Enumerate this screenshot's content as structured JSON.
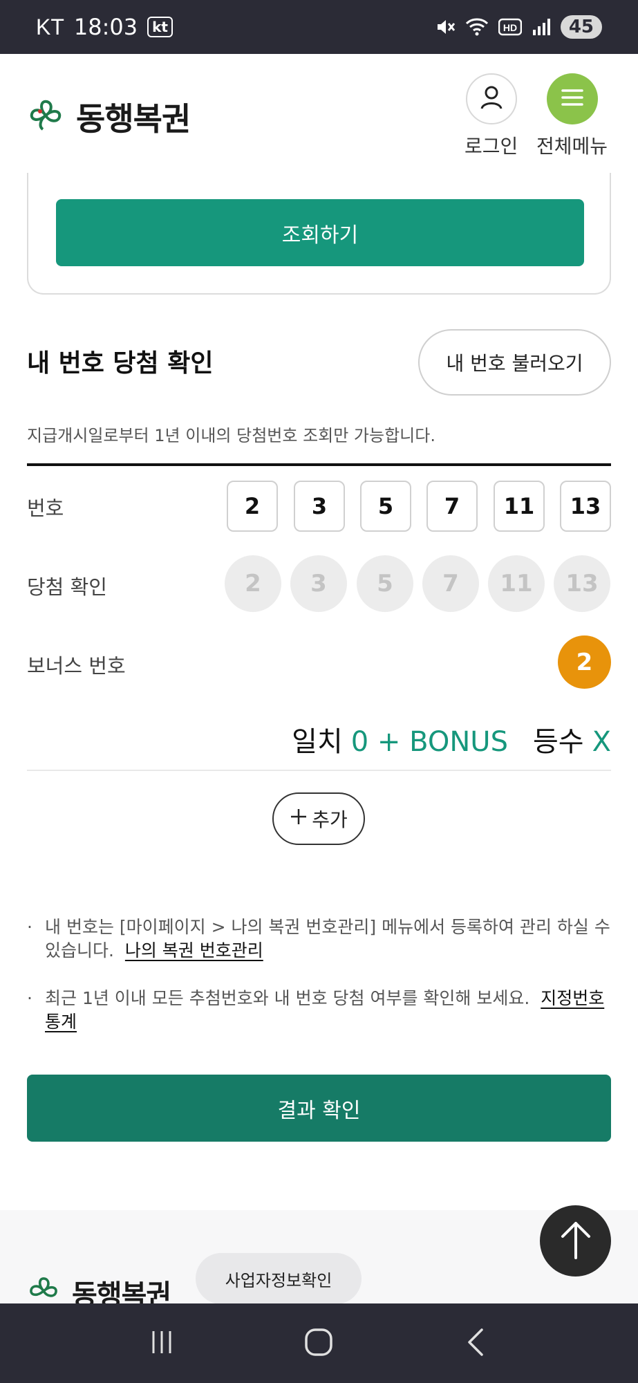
{
  "status_bar": {
    "carrier": "KT",
    "time": "18:03",
    "carrier_badge": "kt",
    "battery": "45"
  },
  "header": {
    "logo_text": "동행복권",
    "login_label": "로그인",
    "menu_label": "전체메뉴"
  },
  "query": {
    "button_label": "조회하기"
  },
  "section": {
    "title": "내 번호 당첨 확인",
    "load_button": "내 번호 불러오기",
    "note": "지급개시일로부터 1년 이내의 당첨번호 조회만 가능합니다."
  },
  "numbers_row": {
    "label": "번호",
    "values": [
      "2",
      "3",
      "5",
      "7",
      "11",
      "13"
    ]
  },
  "match_row": {
    "label": "당첨 확인",
    "values": [
      "2",
      "3",
      "5",
      "7",
      "11",
      "13"
    ]
  },
  "bonus_row": {
    "label": "보너스 번호",
    "value": "2"
  },
  "result": {
    "match_label": "일치",
    "match_value": "0 + BONUS",
    "rank_label": "등수",
    "rank_value": "X"
  },
  "add_button": {
    "label": "추가"
  },
  "info": [
    {
      "text": "내 번호는 [마이페이지 > 나의 복권 번호관리] 메뉴에서 등록하여 관리 하실 수 있습니다.",
      "link": "나의 복권 번호관리"
    },
    {
      "text": "최근 1년 이내 모든 추첨번호와 내 번호 당첨 여부를 확인해 보세요.",
      "link": "지정번호 통계"
    }
  ],
  "result_button": {
    "label": "결과 확인"
  },
  "footer": {
    "logo_text": "동행복권",
    "business_info_button": "사업자정보확인"
  },
  "colors": {
    "primary_green": "#16977c",
    "dark_green": "#167b66",
    "menu_green": "#8bc34a",
    "bonus_orange": "#e8930b"
  },
  "icons": {
    "login": "person-icon",
    "menu": "hamburger-icon",
    "add": "plus-icon",
    "top": "arrow-up-icon"
  }
}
